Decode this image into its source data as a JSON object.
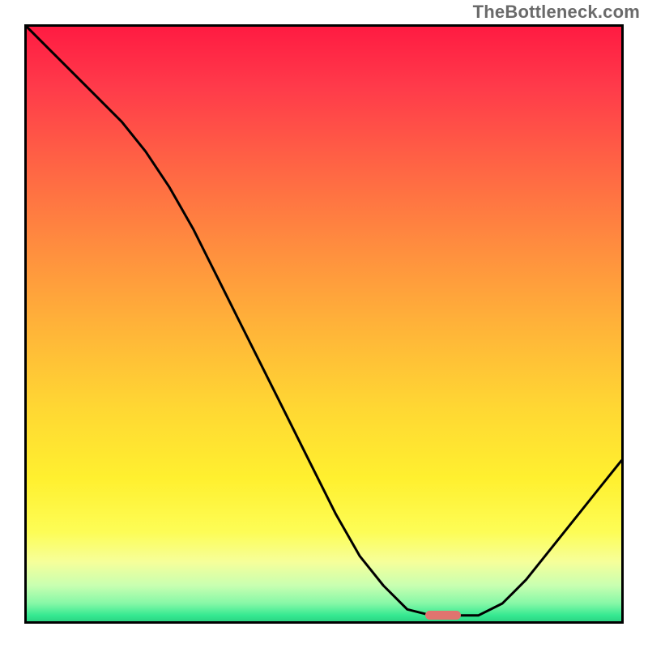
{
  "watermark": "TheBottleneck.com",
  "chart_data": {
    "type": "line",
    "title": "",
    "xlabel": "",
    "ylabel": "",
    "xlim": [
      0,
      100
    ],
    "ylim": [
      0,
      100
    ],
    "series": [
      {
        "name": "curve",
        "x": [
          0,
          4,
          8,
          12,
          16,
          20,
          24,
          28,
          32,
          36,
          40,
          44,
          48,
          52,
          56,
          60,
          64,
          68,
          72,
          76,
          80,
          84,
          88,
          92,
          96,
          100
        ],
        "values": [
          100,
          96,
          92,
          88,
          84,
          79,
          73,
          66,
          58,
          50,
          42,
          34,
          26,
          18,
          11,
          6,
          2,
          1,
          1,
          1,
          3,
          7,
          12,
          17,
          22,
          27
        ]
      }
    ],
    "marker": {
      "x": 70,
      "y": 1,
      "width": 6,
      "height": 1.5,
      "color": "#e0746f"
    },
    "gradient_stops": [
      {
        "pos": 0,
        "color": "#ff1b42"
      },
      {
        "pos": 22,
        "color": "#ff6045"
      },
      {
        "pos": 50,
        "color": "#ffb239"
      },
      {
        "pos": 76,
        "color": "#fff02f"
      },
      {
        "pos": 94,
        "color": "#c8ffb1"
      },
      {
        "pos": 100,
        "color": "#2bd584"
      }
    ]
  }
}
